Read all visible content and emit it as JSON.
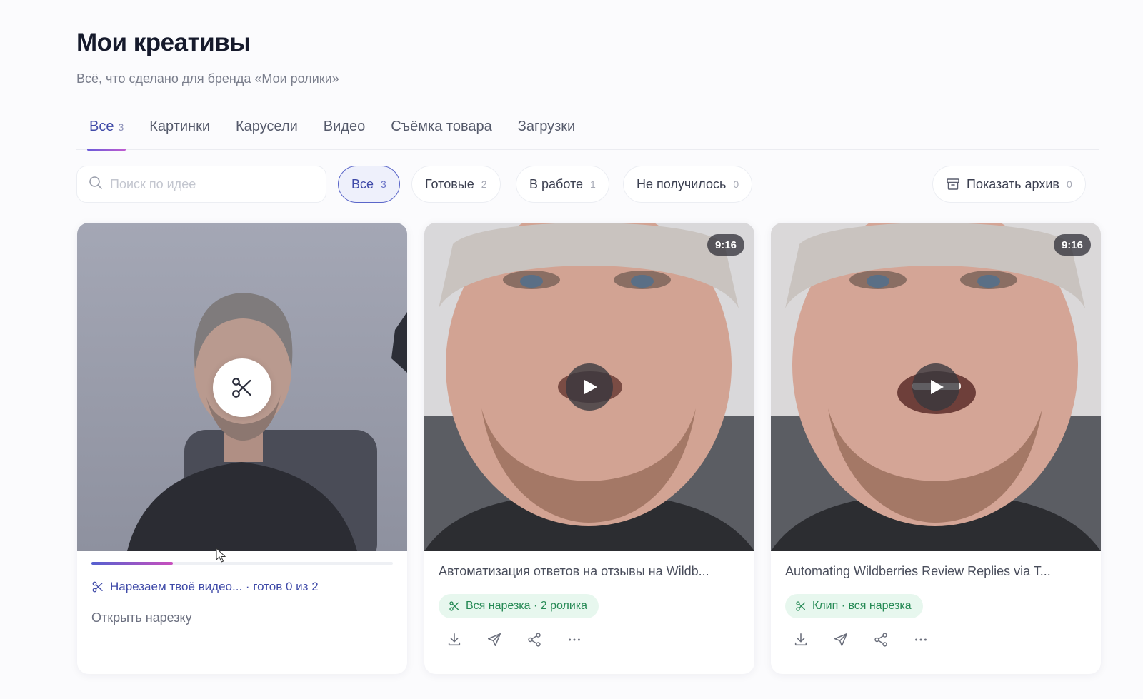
{
  "header": {
    "title": "Мои креативы",
    "subtitle": "Всё, что сделано для бренда «Мои ролики»"
  },
  "tabs": [
    {
      "label": "Все",
      "count": "3",
      "active": true
    },
    {
      "label": "Картинки"
    },
    {
      "label": "Карусели"
    },
    {
      "label": "Видео"
    },
    {
      "label": "Съёмка товара"
    },
    {
      "label": "Загрузки"
    }
  ],
  "search": {
    "placeholder": "Поиск по идее",
    "value": "",
    "icon": "search-icon"
  },
  "filters": [
    {
      "label": "Все",
      "count": "3",
      "active": true
    },
    {
      "label": "Готовые",
      "count": "2"
    },
    {
      "label": "В работе",
      "count": "1"
    },
    {
      "label": "Не получилось",
      "count": "0"
    }
  ],
  "archive": {
    "label": "Показать архив",
    "count": "0",
    "icon": "archive-icon"
  },
  "cards": [
    {
      "state": "processing",
      "progress": 0.27,
      "status_label": "Нарезаем твоё видео...",
      "status_detail": "· готов 0 из 2",
      "open_label": "Открыть нарезку",
      "icon": "scissors-icon"
    },
    {
      "state": "ready",
      "ratio": "9:16",
      "title": "Автоматизация ответов на отзывы на Wildb...",
      "tag": "Вся нарезка · 2 ролика",
      "actions": [
        "download-icon",
        "send-icon",
        "share-icon",
        "more-icon"
      ]
    },
    {
      "state": "ready",
      "ratio": "9:16",
      "title": "Automating Wildberries Review Replies via T...",
      "tag": "Клип · вся нарезка",
      "actions": [
        "download-icon",
        "send-icon",
        "share-icon",
        "more-icon"
      ]
    }
  ],
  "colors": {
    "accent": "#3f4aa8",
    "tag_bg": "#e7f7ee",
    "tag_text": "#268a55",
    "progress_start": "#5560d0",
    "progress_end": "#c94fbd"
  }
}
